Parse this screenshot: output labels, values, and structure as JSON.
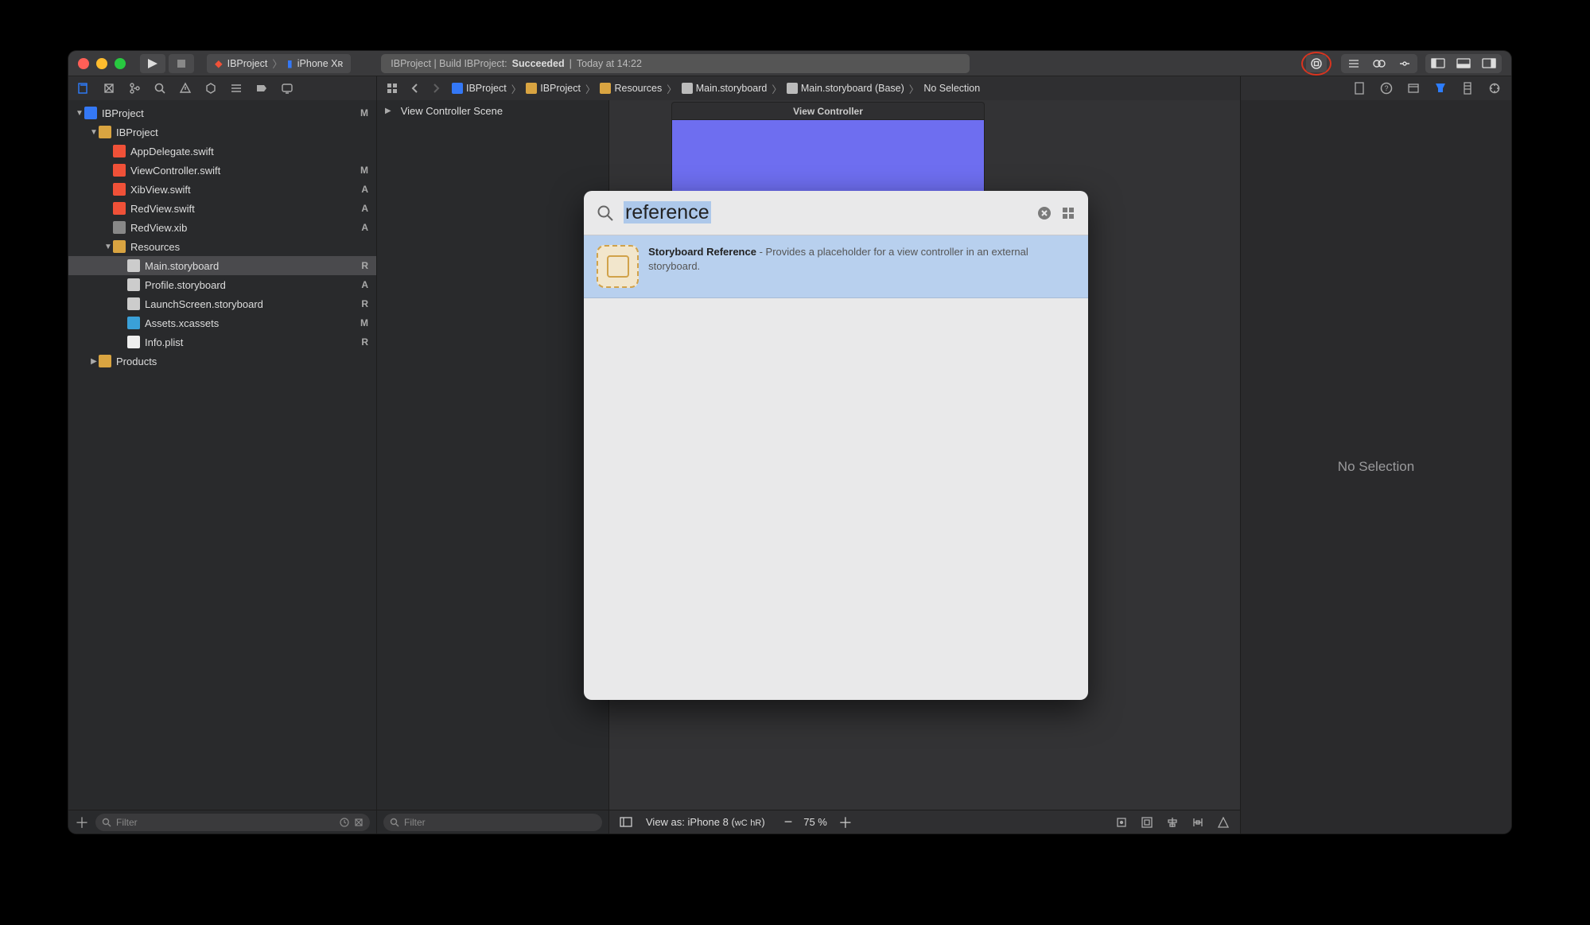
{
  "titlebar": {
    "scheme_project": "IBProject",
    "scheme_device": "iPhone Xʀ",
    "status_prefix": "IBProject | Build IBProject:",
    "status_result": "Succeeded",
    "status_time": "Today at 14:22"
  },
  "crumbs": [
    "IBProject",
    "IBProject",
    "Resources",
    "Main.storyboard",
    "Main.storyboard (Base)",
    "No Selection"
  ],
  "tree": [
    {
      "depth": 0,
      "icon": "fi-proj",
      "name": "IBProject",
      "badge": "M",
      "disclosure": "▼"
    },
    {
      "depth": 1,
      "icon": "fi-folder",
      "name": "IBProject",
      "badge": "",
      "disclosure": "▼"
    },
    {
      "depth": 2,
      "icon": "fi-swift",
      "name": "AppDelegate.swift",
      "badge": "",
      "disclosure": ""
    },
    {
      "depth": 2,
      "icon": "fi-swift",
      "name": "ViewController.swift",
      "badge": "M",
      "disclosure": ""
    },
    {
      "depth": 2,
      "icon": "fi-swift",
      "name": "XibView.swift",
      "badge": "A",
      "disclosure": ""
    },
    {
      "depth": 2,
      "icon": "fi-swift",
      "name": "RedView.swift",
      "badge": "A",
      "disclosure": ""
    },
    {
      "depth": 2,
      "icon": "fi-xib",
      "name": "RedView.xib",
      "badge": "A",
      "disclosure": ""
    },
    {
      "depth": 2,
      "icon": "fi-folder",
      "name": "Resources",
      "badge": "",
      "disclosure": "▼"
    },
    {
      "depth": 3,
      "icon": "fi-sb",
      "name": "Main.storyboard",
      "badge": "R",
      "disclosure": "",
      "selected": true
    },
    {
      "depth": 3,
      "icon": "fi-sb",
      "name": "Profile.storyboard",
      "badge": "A",
      "disclosure": ""
    },
    {
      "depth": 3,
      "icon": "fi-sb",
      "name": "LaunchScreen.storyboard",
      "badge": "R",
      "disclosure": ""
    },
    {
      "depth": 3,
      "icon": "fi-assets",
      "name": "Assets.xcassets",
      "badge": "M",
      "disclosure": ""
    },
    {
      "depth": 3,
      "icon": "fi-plist",
      "name": "Info.plist",
      "badge": "R",
      "disclosure": ""
    },
    {
      "depth": 1,
      "icon": "fi-folder",
      "name": "Products",
      "badge": "",
      "disclosure": "▶"
    }
  ],
  "outline": {
    "scene": "View Controller Scene"
  },
  "device": {
    "title": "View Controller"
  },
  "canvas_footer": {
    "view_as": "View as: iPhone 8 (",
    "wc": "wC",
    "hr": "hR",
    "close": ")",
    "zoom": "75 %"
  },
  "filter_placeholder": "Filter",
  "inspector": {
    "empty": "No Selection"
  },
  "library": {
    "query": "reference",
    "result_title": "Storyboard Reference",
    "result_desc": " - Provides a placeholder for a view controller in an external storyboard."
  }
}
